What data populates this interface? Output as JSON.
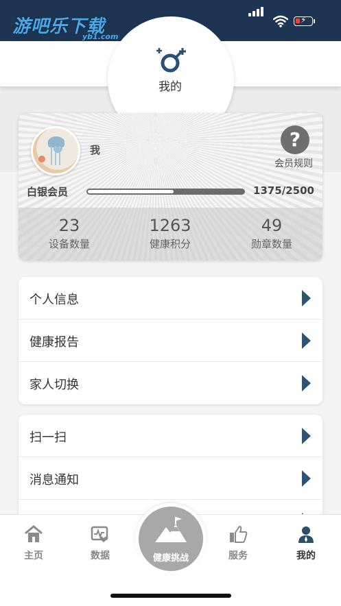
{
  "status_bar": {
    "watermark_logo": "游吧乐下载",
    "watermark_sub": "yb1.com"
  },
  "header": {
    "title": "我的",
    "icon": "gender-symbol-icon"
  },
  "profile": {
    "username": "我",
    "rules_label": "会员规则",
    "level": "白银会员",
    "progress_text": "1375/2500",
    "progress_fraction": 0.55,
    "stats": [
      {
        "value": "23",
        "label": "设备数量"
      },
      {
        "value": "1263",
        "label": "健康积分"
      },
      {
        "value": "49",
        "label": "勋章数量"
      }
    ]
  },
  "menu_group_1": [
    {
      "label": "个人信息"
    },
    {
      "label": "健康报告"
    },
    {
      "label": "家人切换"
    }
  ],
  "menu_group_2": [
    {
      "label": "扫一扫"
    },
    {
      "label": "消息通知"
    },
    {
      "label": ""
    }
  ],
  "tabbar": {
    "tabs": [
      {
        "label": "主页",
        "icon": "home-icon"
      },
      {
        "label": "数据",
        "icon": "data-monitor-icon"
      },
      {
        "label": "服务",
        "icon": "thumbs-up-icon"
      },
      {
        "label": "我的",
        "icon": "user-icon"
      }
    ],
    "center_label": "健康挑战",
    "center_icon": "mountain-flag-icon",
    "active_tab": "我的"
  },
  "colors": {
    "status_bar": "#1d3553",
    "chevron": "#2b5573",
    "battery_low": "#ff3b30"
  }
}
